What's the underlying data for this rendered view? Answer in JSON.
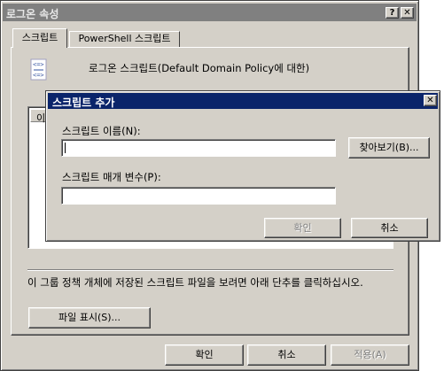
{
  "logon_dialog": {
    "title": "로그온 속성",
    "help_glyph": "?",
    "close_glyph": "✕",
    "tabs": [
      {
        "label": "스크립트",
        "active": true
      },
      {
        "label": "PowerShell 스크립트",
        "active": false
      }
    ],
    "heading": "로그온 스크립트(Default Domain Policy에 대한)",
    "list_column_fragment": "이름",
    "info_text": "이 그룹 정책 개체에 저장된 스크립트 파일을 보려면 아래 단추를 클릭하십시오.",
    "show_files_button": "파일 표시(S)...",
    "ok_button": "확인",
    "cancel_button": "취소",
    "apply_button": "적용(A)"
  },
  "add_script_dialog": {
    "title": "스크립트 추가",
    "close_glyph": "✕",
    "script_name_label": "스크립트 이름(N):",
    "script_name_value": "",
    "browse_button": "찾아보기(B)...",
    "script_params_label": "스크립트 매개 변수(P):",
    "script_params_value": "",
    "ok_button": "확인",
    "cancel_button": "취소"
  },
  "colors": {
    "dialog_face": "#d4d0c8",
    "active_title": "#0a246a",
    "inactive_title": "#808080"
  }
}
